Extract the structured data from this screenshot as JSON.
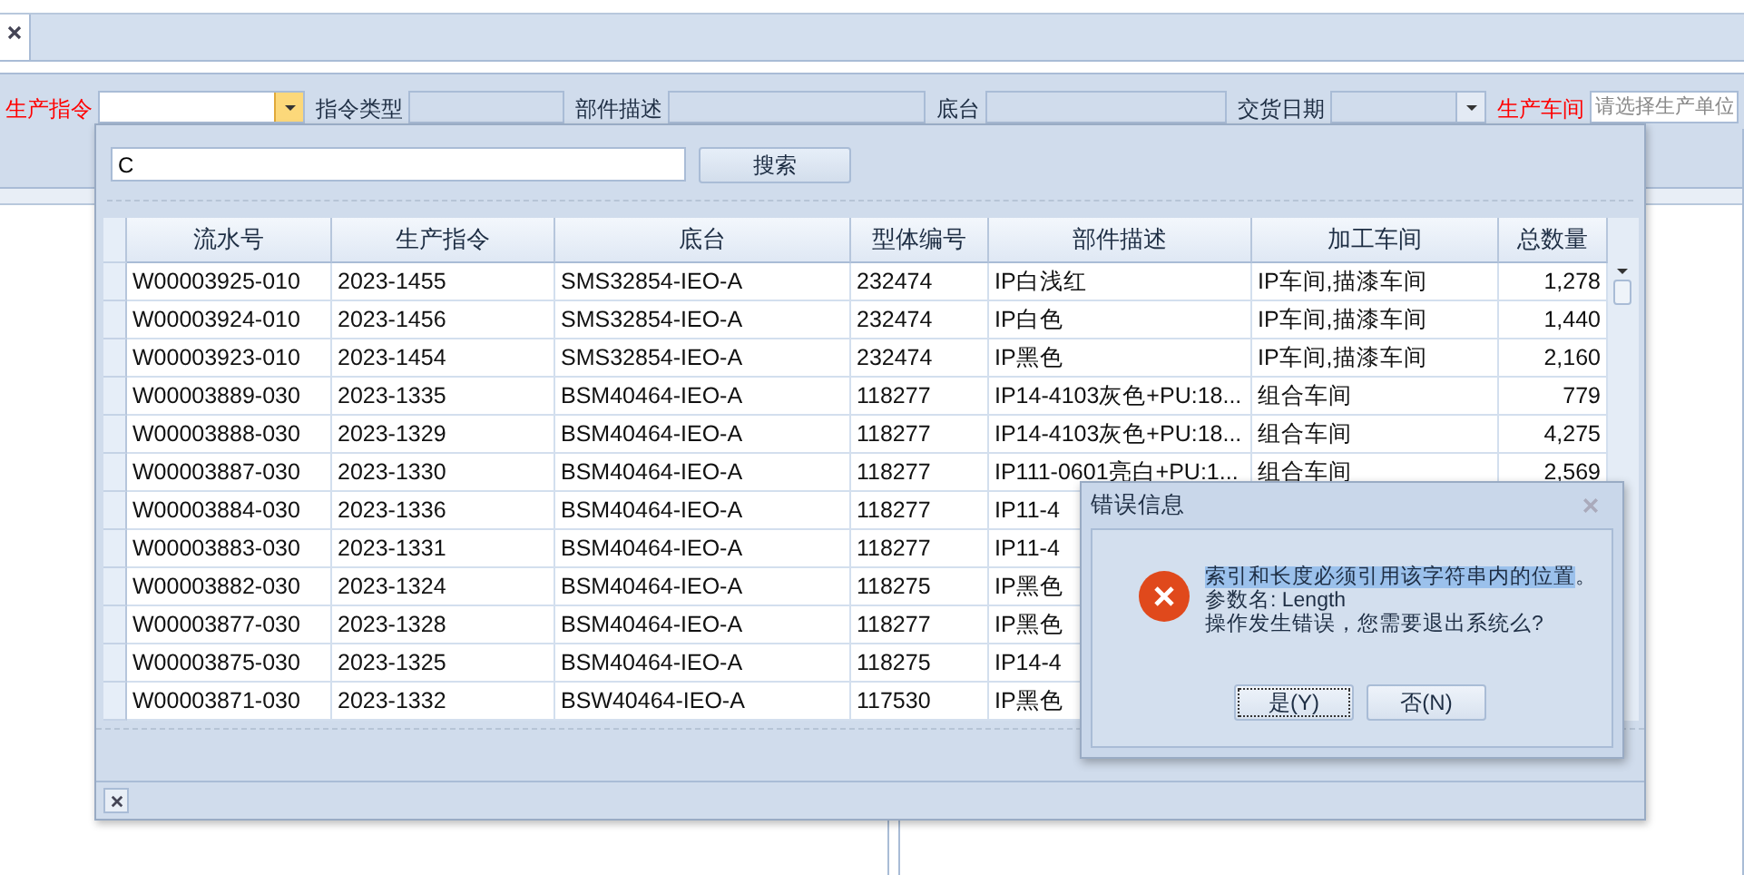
{
  "tabs": [
    {
      "kind": "close",
      "selected": true
    }
  ],
  "filters": [
    {
      "label": "生产指令",
      "required": true,
      "kind": "combo",
      "active": true
    },
    {
      "label": "指令类型",
      "required": false,
      "kind": "text"
    },
    {
      "label": "部件描述",
      "required": false,
      "kind": "text"
    },
    {
      "label": "底台",
      "required": false,
      "kind": "text"
    },
    {
      "label": "交货日期",
      "required": false,
      "kind": "combo",
      "active": false
    },
    {
      "label": "生产车间",
      "required": true,
      "kind": "text",
      "placeholder": "请选择生产单位"
    }
  ],
  "popup": {
    "search": {
      "value": "C"
    },
    "search_button": "搜索",
    "columns": [
      "流水号",
      "生产指令",
      "底台",
      "型体编号",
      "部件描述",
      "加工车间",
      "总数量"
    ],
    "rows": [
      [
        "W00003925-010",
        "2023-1455",
        "SMS32854-IEO-A",
        "232474",
        "IP白浅红",
        "IP车间,描漆车间",
        "1,278"
      ],
      [
        "W00003924-010",
        "2023-1456",
        "SMS32854-IEO-A",
        "232474",
        "IP白色",
        "IP车间,描漆车间",
        "1,440"
      ],
      [
        "W00003923-010",
        "2023-1454",
        "SMS32854-IEO-A",
        "232474",
        "IP黑色",
        "IP车间,描漆车间",
        "2,160"
      ],
      [
        "W00003889-030",
        "2023-1335",
        "BSM40464-IEO-A",
        "118277",
        "IP14-4103灰色+PU:18...",
        "组合车间",
        "779"
      ],
      [
        "W00003888-030",
        "2023-1329",
        "BSM40464-IEO-A",
        "118277",
        "IP14-4103灰色+PU:18...",
        "组合车间",
        "4,275"
      ],
      [
        "W00003887-030",
        "2023-1330",
        "BSM40464-IEO-A",
        "118277",
        "IP111-0601亮白+PU:1...",
        "组合车间",
        "2,569"
      ],
      [
        "W00003884-030",
        "2023-1336",
        "BSM40464-IEO-A",
        "118277",
        "IP11-4"
      ],
      [
        "W00003883-030",
        "2023-1331",
        "BSM40464-IEO-A",
        "118277",
        "IP11-4"
      ],
      [
        "W00003882-030",
        "2023-1324",
        "BSM40464-IEO-A",
        "118275",
        "IP黑色"
      ],
      [
        "W00003877-030",
        "2023-1328",
        "BSM40464-IEO-A",
        "118277",
        "IP黑色"
      ],
      [
        "W00003875-030",
        "2023-1325",
        "BSM40464-IEO-A",
        "118275",
        "IP14-4"
      ],
      [
        "W00003871-030",
        "2023-1332",
        "BSW40464-IEO-A",
        "117530",
        "IP黑色"
      ]
    ]
  },
  "dialog": {
    "title": "错误信息",
    "lines": [
      [
        {
          "text": "索引和长度必须引用该字符串内的位置",
          "selected": true
        },
        {
          "text": "。",
          "selected": false
        }
      ],
      [
        {
          "text": "参数名: Length",
          "selected": false
        }
      ],
      [
        {
          "text": "操作发生错误，您需要退出系统么?",
          "selected": false
        }
      ]
    ],
    "buttons": [
      {
        "label": "是(Y)",
        "focused": true
      },
      {
        "label": "否(N)",
        "focused": false
      }
    ]
  }
}
